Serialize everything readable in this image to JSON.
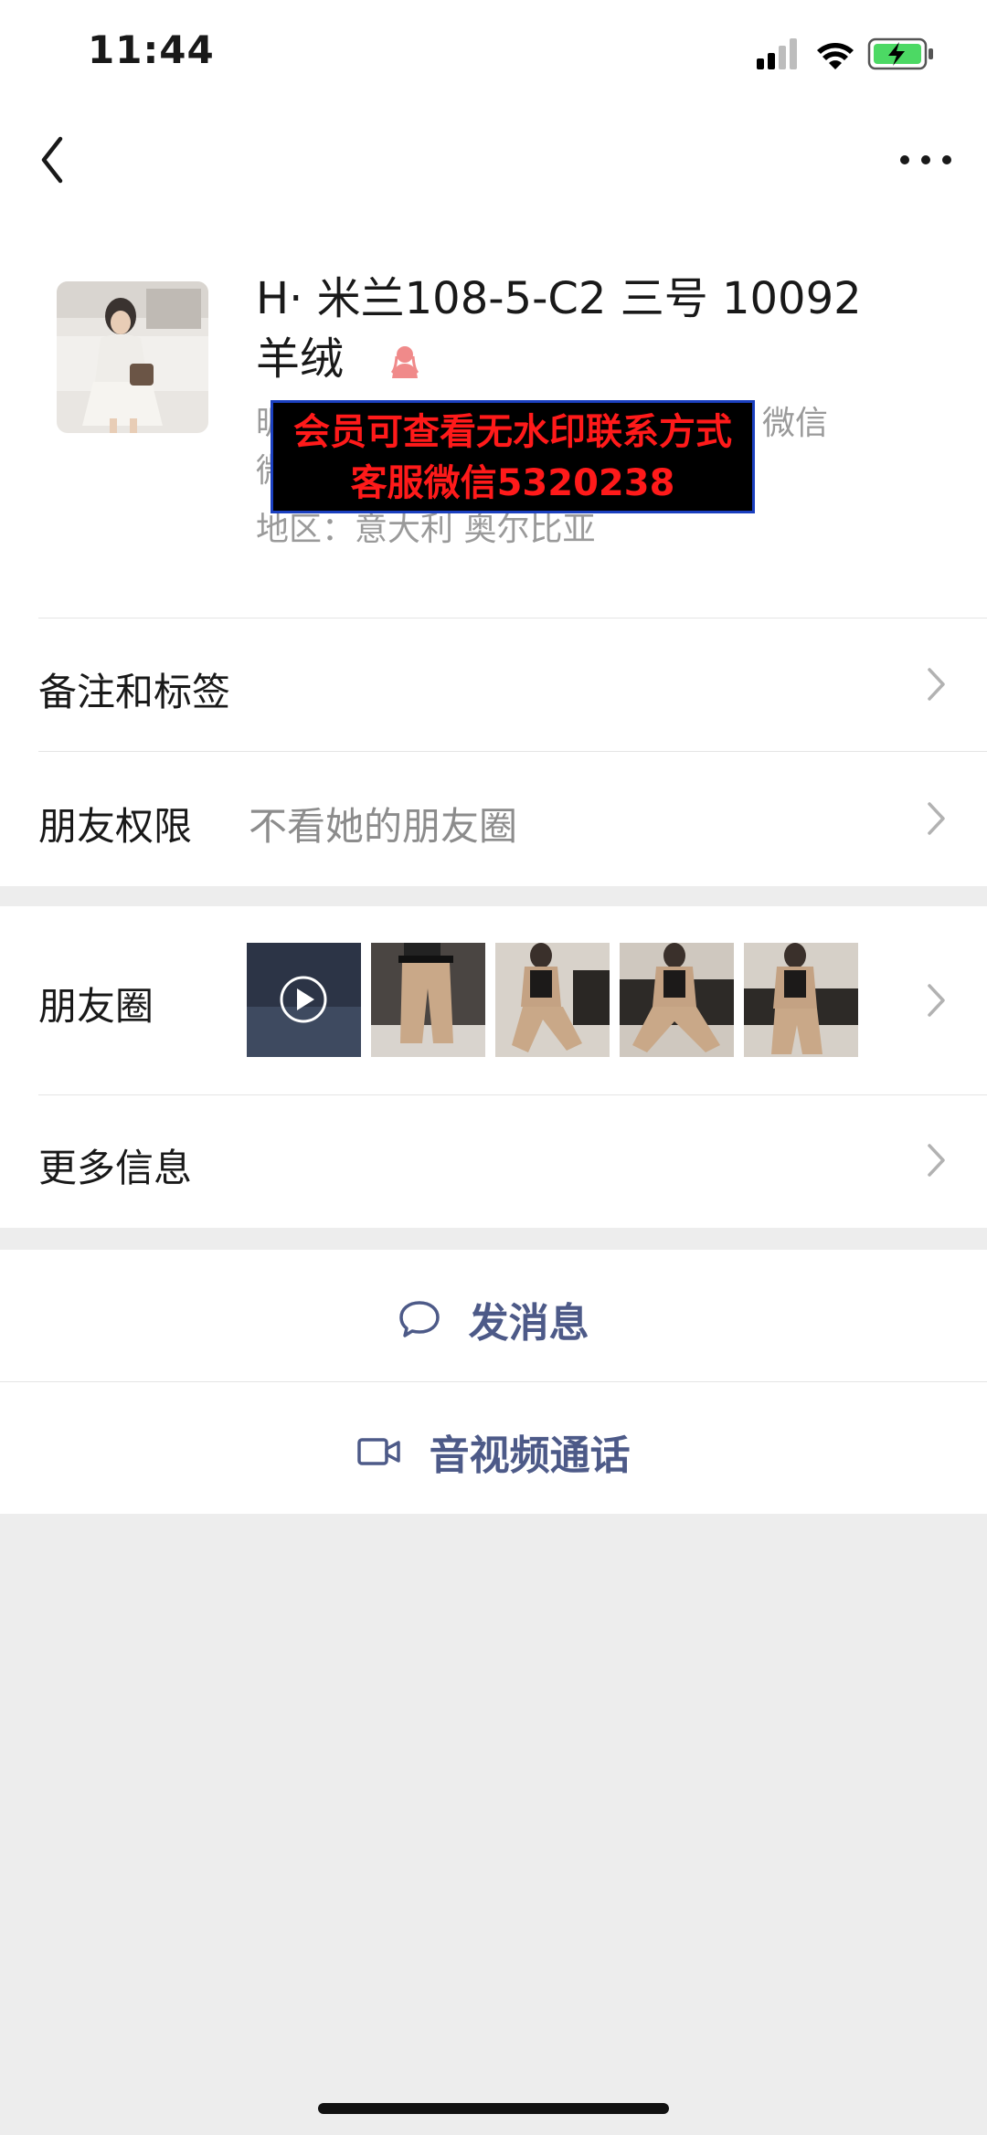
{
  "status": {
    "time": "11:44"
  },
  "profile": {
    "name_line1": "H· 米兰108-5-C2 三号 10092",
    "name_line2": "羊绒",
    "info_nickname_prefix": "昵",
    "info_nickname_suffix": "微信",
    "info_wechat_prefix": "微",
    "info_region": "地区：意大利 奥尔比亚",
    "watermark_line1": "会员可查看无水印联系方式",
    "watermark_line2": "客服微信5320238"
  },
  "cells": {
    "remarks_label": "备注和标签",
    "permission_label": "朋友权限",
    "permission_value": "不看她的朋友圈",
    "moments_label": "朋友圈",
    "more_info_label": "更多信息"
  },
  "actions": {
    "message_label": "发消息",
    "call_label": "音视频通话"
  },
  "icons": [
    "back-icon",
    "more-icon",
    "signal-icon",
    "wifi-icon",
    "battery-icon",
    "female-icon",
    "chevron-right-icon",
    "play-icon",
    "chat-bubble-icon",
    "video-camera-icon"
  ],
  "colors": {
    "accent": "#4d5a88",
    "watermark_text": "#ff1a1a",
    "battery": "#4cd964"
  }
}
